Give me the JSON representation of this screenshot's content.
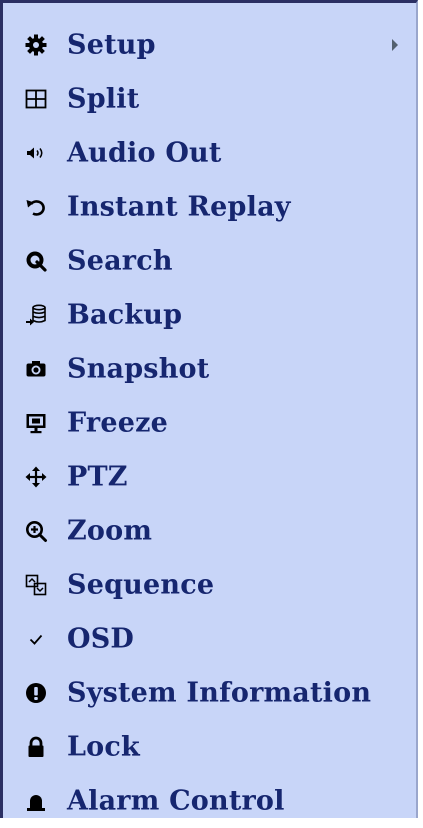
{
  "menu": {
    "items": [
      {
        "label": "Setup",
        "icon": "gear-icon",
        "has_submenu": true
      },
      {
        "label": "Split",
        "icon": "split-grid-icon"
      },
      {
        "label": "Audio Out",
        "icon": "speaker-icon"
      },
      {
        "label": "Instant Replay",
        "icon": "replay-arrow-icon"
      },
      {
        "label": "Search",
        "icon": "search-icon"
      },
      {
        "label": "Backup",
        "icon": "backup-database-icon"
      },
      {
        "label": "Snapshot",
        "icon": "camera-icon"
      },
      {
        "label": "Freeze",
        "icon": "monitor-icon"
      },
      {
        "label": "PTZ",
        "icon": "move-arrows-icon"
      },
      {
        "label": "Zoom",
        "icon": "zoom-in-icon"
      },
      {
        "label": "Sequence",
        "icon": "sequence-icon"
      },
      {
        "label": "OSD",
        "icon": "checkmark-icon"
      },
      {
        "label": "System Information",
        "icon": "info-icon"
      },
      {
        "label": "Lock",
        "icon": "lock-icon"
      },
      {
        "label": "Alarm Control",
        "icon": "alarm-icon"
      }
    ]
  },
  "colors": {
    "menu_background": "#c8d5f8",
    "label_text": "#16266f",
    "border": "#2b2f63"
  }
}
